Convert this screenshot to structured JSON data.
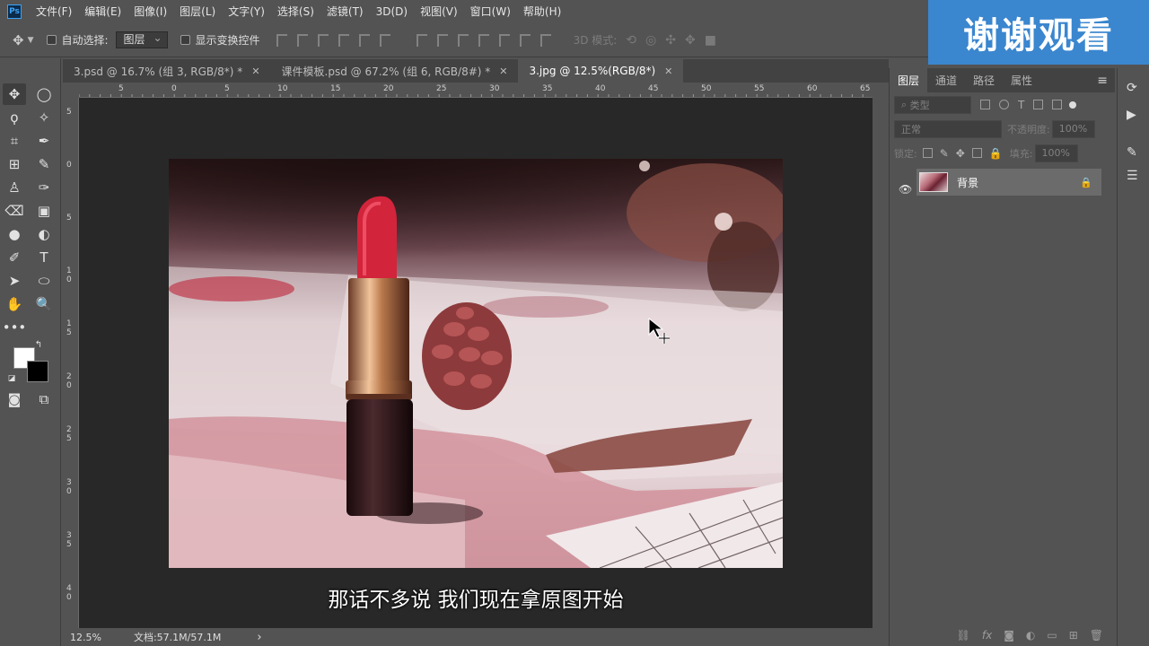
{
  "menubar": {
    "logo": "Ps",
    "items": [
      "文件(F)",
      "编辑(E)",
      "图像(I)",
      "图层(L)",
      "文字(Y)",
      "选择(S)",
      "滤镜(T)",
      "3D(D)",
      "视图(V)",
      "窗口(W)",
      "帮助(H)"
    ]
  },
  "overlay": {
    "thanks": "谢谢观看"
  },
  "options": {
    "auto_select_label": "自动选择:",
    "auto_select_value": "图层",
    "show_transform_label": "显示变换控件",
    "mode3d_label": "3D 模式:"
  },
  "tabs": [
    {
      "label": "3.psd @ 16.7% (组 3, RGB/8*) *"
    },
    {
      "label": "课件模板.psd @ 67.2% (组 6, RGB/8#) *"
    },
    {
      "label": "3.jpg @ 12.5%(RGB/8*)"
    }
  ],
  "ruler_top": [
    "5",
    "0",
    "5",
    "10",
    "15",
    "20",
    "25",
    "30",
    "35",
    "40",
    "45",
    "50",
    "55",
    "60",
    "65"
  ],
  "ruler_left": [
    "5",
    "0",
    "5",
    "1 0",
    "1 5",
    "2 0",
    "2 5",
    "3 0",
    "3 5",
    "4 0"
  ],
  "subtitle": "那话不多说 我们现在拿原图开始",
  "status": {
    "zoom": "12.5%",
    "doc": "文档:57.1M/57.1M",
    "arrow": "›"
  },
  "layers_panel": {
    "tabs": [
      "图层",
      "通道",
      "路径",
      "属性"
    ],
    "filter_placeholder": "类型",
    "blend_mode": "正常",
    "opacity_label": "不透明度:",
    "opacity_value": "100%",
    "lock_label": "锁定:",
    "fill_label": "填充:",
    "fill_value": "100%",
    "layer_name": "背景"
  },
  "colors": {
    "foreground": "#ffffff",
    "background": "#000000",
    "accent": "#3a86cf",
    "lipstick": "#d2243b"
  }
}
